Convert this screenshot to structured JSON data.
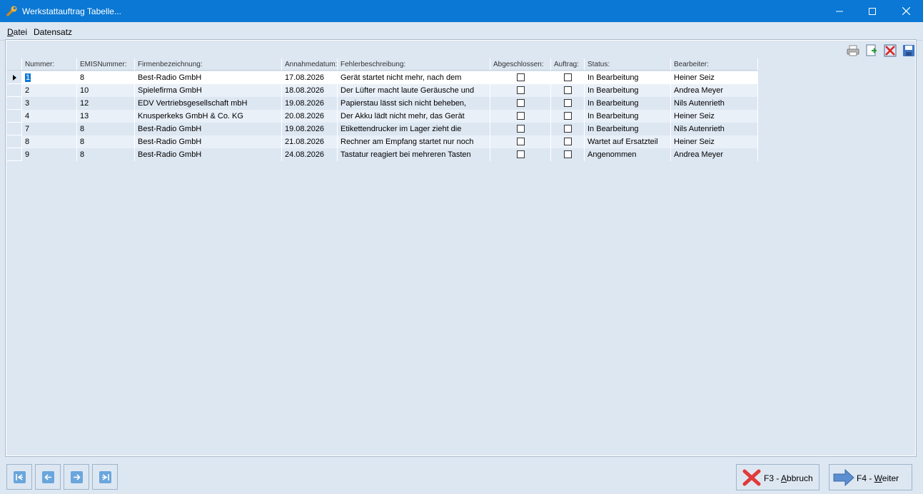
{
  "window": {
    "title": "Werkstattauftrag Tabelle..."
  },
  "menu": {
    "items": [
      {
        "label": "Datei"
      },
      {
        "label": "Datensatz"
      }
    ]
  },
  "toolbar": {
    "icons": [
      "printer-icon",
      "export-icon",
      "delete-icon",
      "save-icon"
    ]
  },
  "grid": {
    "columns": [
      "Nummer:",
      "EMISNummer:",
      "Firmenbezeichnung:",
      "Annahmedatum:",
      "Fehlerbeschreibung:",
      "Abgeschlossen:",
      "Auftrag:",
      "Status:",
      "Bearbeiter:"
    ],
    "rows": [
      {
        "nummer": "1",
        "emis": "8",
        "firma": "Best-Radio GmbH",
        "datum": "17.08.2026",
        "fehler": "Gerät startet nicht mehr, nach dem",
        "abgeschlossen": false,
        "auftrag": false,
        "status": "In Bearbeitung",
        "bearbeiter": "Heiner Seiz"
      },
      {
        "nummer": "2",
        "emis": "10",
        "firma": "Spielefirma GmbH",
        "datum": "18.08.2026",
        "fehler": "Der Lüfter macht laute Geräusche und",
        "abgeschlossen": false,
        "auftrag": false,
        "status": "In Bearbeitung",
        "bearbeiter": "Andrea Meyer"
      },
      {
        "nummer": "3",
        "emis": "12",
        "firma": "EDV Vertriebsgesellschaft mbH",
        "datum": "19.08.2026",
        "fehler": "Papierstau lässt sich nicht beheben,",
        "abgeschlossen": false,
        "auftrag": false,
        "status": "In Bearbeitung",
        "bearbeiter": "Nils Autenrieth"
      },
      {
        "nummer": "4",
        "emis": "13",
        "firma": "Knusperkeks GmbH & Co. KG",
        "datum": "20.08.2026",
        "fehler": "Der Akku lädt nicht mehr, das Gerät",
        "abgeschlossen": false,
        "auftrag": false,
        "status": "In Bearbeitung",
        "bearbeiter": "Heiner Seiz"
      },
      {
        "nummer": "7",
        "emis": "8",
        "firma": "Best-Radio GmbH",
        "datum": "19.08.2026",
        "fehler": "Etikettendrucker im Lager zieht die",
        "abgeschlossen": false,
        "auftrag": false,
        "status": "In Bearbeitung",
        "bearbeiter": "Nils Autenrieth"
      },
      {
        "nummer": "8",
        "emis": "8",
        "firma": "Best-Radio GmbH",
        "datum": "21.08.2026",
        "fehler": "Rechner am Empfang startet nur noch",
        "abgeschlossen": false,
        "auftrag": false,
        "status": "Wartet auf Ersatzteil",
        "bearbeiter": "Heiner Seiz"
      },
      {
        "nummer": "9",
        "emis": "8",
        "firma": "Best-Radio GmbH",
        "datum": "24.08.2026",
        "fehler": "Tastatur reagiert bei mehreren Tasten",
        "abgeschlossen": false,
        "auftrag": false,
        "status": "Angenommen",
        "bearbeiter": "Andrea Meyer"
      }
    ]
  },
  "nav": {
    "icons": [
      "first-record-icon",
      "previous-record-icon",
      "next-record-icon",
      "last-record-icon"
    ]
  },
  "buttons": {
    "cancel": {
      "key": "F3 - ",
      "accel": "A",
      "rest": "bbruch"
    },
    "next": {
      "key": "F4 - ",
      "accel": "W",
      "rest": "eiter"
    }
  },
  "colors": {
    "titlebar": "#0a78d4",
    "background": "#dde7f2",
    "accent_blue": "#6aa6dc"
  }
}
